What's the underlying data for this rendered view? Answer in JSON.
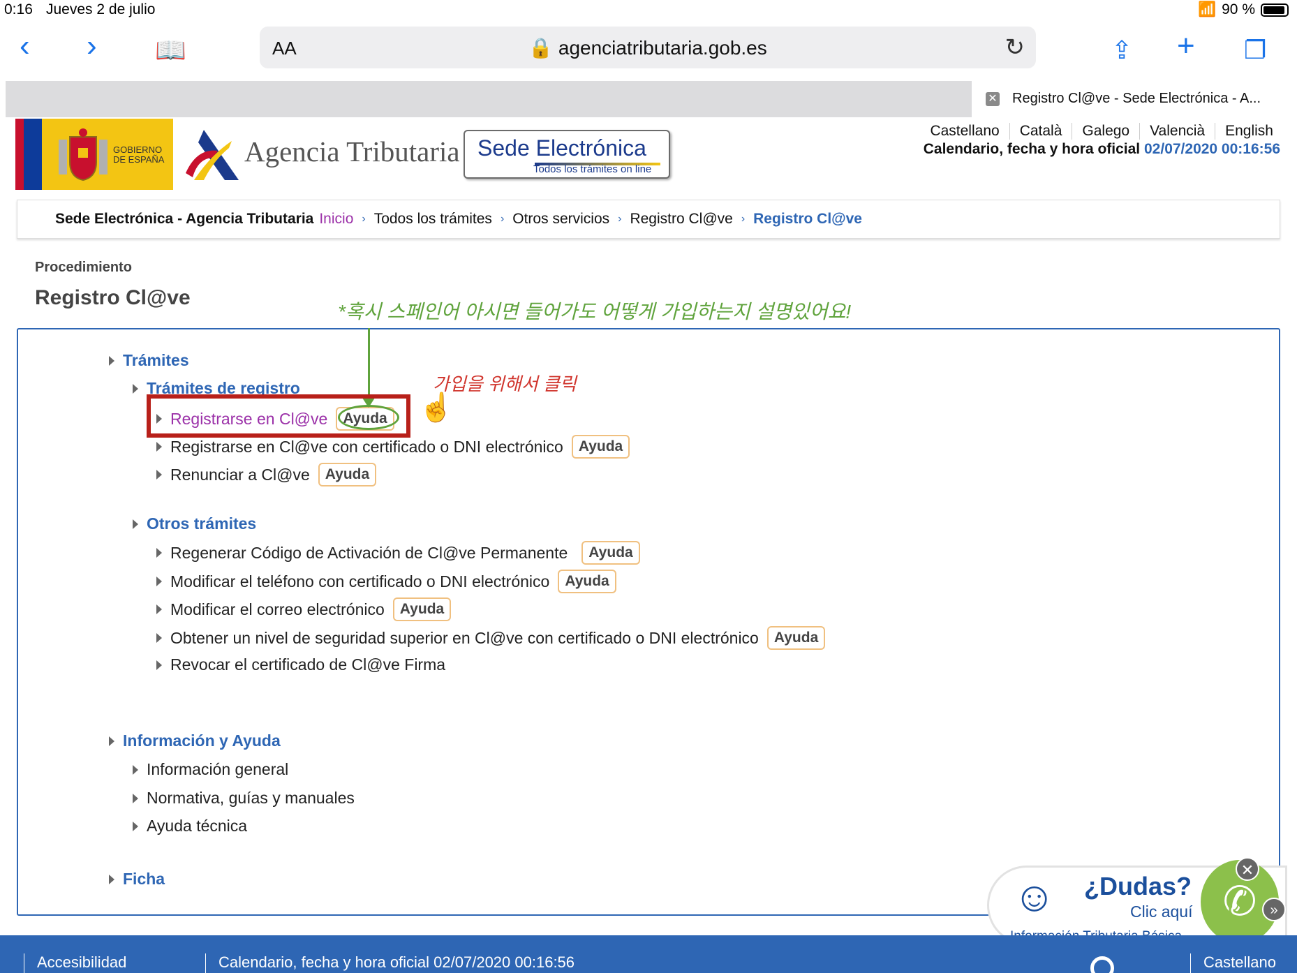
{
  "status_bar": {
    "time": "0:16",
    "date": "Jueves 2 de julio",
    "battery": "90 %"
  },
  "browser": {
    "text_size_label": "AA",
    "url": "agenciatributaria.gob.es",
    "tab_title": "Registro Cl@ve - Sede Electrónica - A..."
  },
  "header": {
    "gobierno_line1": "GOBIERNO",
    "gobierno_line2": "DE ESPAÑA",
    "agencia_name": "Agencia Tributaria",
    "sede_title": "Sede Electrónica",
    "sede_subtitle": "Todos los trámites on line",
    "languages": [
      "Castellano",
      "Català",
      "Galego",
      "Valencià",
      "English"
    ],
    "calendar_label": "Calendario, fecha y hora oficial",
    "calendar_datetime": "02/07/2020 00:16:56"
  },
  "breadcrumb": {
    "site": "Sede Electrónica - Agencia Tributaria",
    "home": "Inicio",
    "items": [
      "Todos los trámites",
      "Otros servicios",
      "Registro Cl@ve"
    ],
    "current": "Registro Cl@ve"
  },
  "page": {
    "label": "Procedimiento",
    "title": "Registro Cl@ve"
  },
  "annotations": {
    "green_note": "*혹시 스페인어 아시면 들어가도 어떻게 가입하는지 설명있어요!",
    "red_note": "가입을 위해서 클릭"
  },
  "tramites": {
    "heading": "Trámites",
    "registro": {
      "heading": "Trámites de registro",
      "items": [
        {
          "label": "Registrarse en Cl@ve",
          "help": "Ayuda"
        },
        {
          "label": "Registrarse en Cl@ve con certificado o DNI electrónico",
          "help": "Ayuda"
        },
        {
          "label": "Renunciar a Cl@ve",
          "help": "Ayuda"
        }
      ]
    },
    "otros": {
      "heading": "Otros trámites",
      "items": [
        {
          "label": "Regenerar Código de Activación de Cl@ve Permanente",
          "help": "Ayuda"
        },
        {
          "label": "Modificar el teléfono con certificado o DNI electrónico",
          "help": "Ayuda"
        },
        {
          "label": "Modificar el correo electrónico",
          "help": "Ayuda"
        },
        {
          "label": "Obtener un nivel de seguridad superior en Cl@ve con certificado o DNI electrónico",
          "help": "Ayuda"
        },
        {
          "label": "Revocar el certificado de Cl@ve Firma"
        }
      ]
    }
  },
  "informacion": {
    "heading": "Información y Ayuda",
    "items": [
      "Información general",
      "Normativa, guías y manuales",
      "Ayuda técnica"
    ]
  },
  "ficha": {
    "heading": "Ficha"
  },
  "dudas_widget": {
    "title": "¿Dudas?",
    "cta": "Clic aquí",
    "subtitle": "Información Tributaria Básica"
  },
  "footer": {
    "accesibilidad": "Accesibilidad",
    "calendar": "Calendario, fecha y hora oficial 02/07/2020 00:16:56",
    "language": "Castellano"
  },
  "colors": {
    "link_blue": "#2e66b4",
    "visited_purple": "#9b30a8",
    "annotation_red": "#b8201a",
    "annotation_green": "#5fa33c"
  }
}
